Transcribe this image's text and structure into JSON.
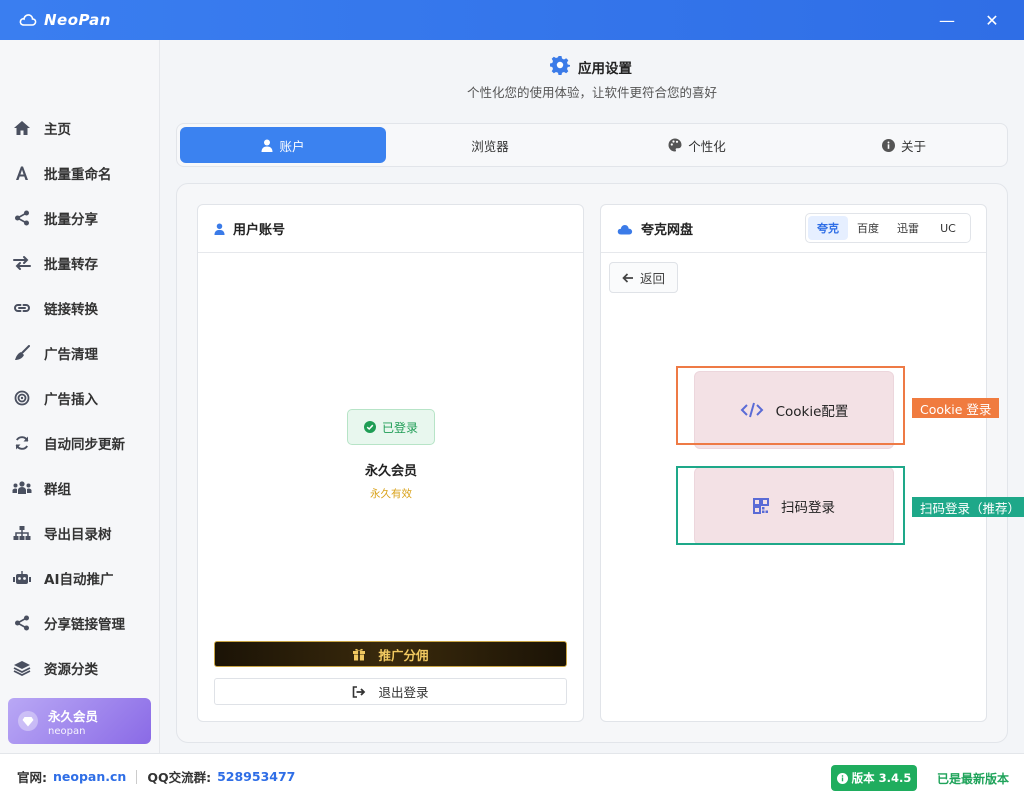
{
  "window": {
    "title": "NeoPan",
    "minimize": "—",
    "close": "✕"
  },
  "sidebar": {
    "items": [
      {
        "label": "主页",
        "icon": "home-icon"
      },
      {
        "label": "批量重命名",
        "icon": "font-a-icon"
      },
      {
        "label": "批量分享",
        "icon": "share-icon"
      },
      {
        "label": "批量转存",
        "icon": "transfer-icon"
      },
      {
        "label": "链接转换",
        "icon": "link-icon"
      },
      {
        "label": "广告清理",
        "icon": "broom-icon"
      },
      {
        "label": "广告插入",
        "icon": "target-icon"
      },
      {
        "label": "自动同步更新",
        "icon": "sync-icon"
      },
      {
        "label": "群组",
        "icon": "group-icon"
      },
      {
        "label": "导出目录树",
        "icon": "sitemap-icon"
      },
      {
        "label": "AI自动推广",
        "icon": "robot-icon"
      },
      {
        "label": "分享链接管理",
        "icon": "share-icon"
      },
      {
        "label": "资源分类",
        "icon": "layers-icon"
      }
    ],
    "member": {
      "title": "永久会员",
      "username": "neopan"
    }
  },
  "header": {
    "title": "应用设置",
    "subtitle": "个性化您的使用体验，让软件更符合您的喜好"
  },
  "tabs": [
    {
      "label": "账户",
      "icon": "user-icon",
      "active": true
    },
    {
      "label": "浏览器",
      "icon": "",
      "active": false
    },
    {
      "label": "个性化",
      "icon": "palette-icon",
      "active": false
    },
    {
      "label": "关于",
      "icon": "info-icon",
      "active": false
    }
  ],
  "account": {
    "heading": "用户账号",
    "status": "已登录",
    "membership": "永久会员",
    "validity": "永久有效",
    "promo_button": "推广分佣",
    "logout_button": "退出登录"
  },
  "cloud": {
    "heading": "夸克网盘",
    "providers": [
      {
        "label": "夸克",
        "active": true
      },
      {
        "label": "百度",
        "active": false
      },
      {
        "label": "迅雷",
        "active": false
      },
      {
        "label": "UC",
        "active": false
      }
    ],
    "back_button": "返回",
    "cookie_option": "Cookie配置",
    "qr_option": "扫码登录"
  },
  "annotations": {
    "cookie_label": "Cookie 登录",
    "qr_label": "扫码登录（推荐）",
    "colors": {
      "orange": "#f07b3f",
      "green": "#1ea889"
    }
  },
  "footer": {
    "site_label": "官网:",
    "site_value": "neopan.cn",
    "qq_label": "QQ交流群:",
    "qq_value": "528953477",
    "version": "版本 3.4.5",
    "latest": "已是最新版本"
  }
}
